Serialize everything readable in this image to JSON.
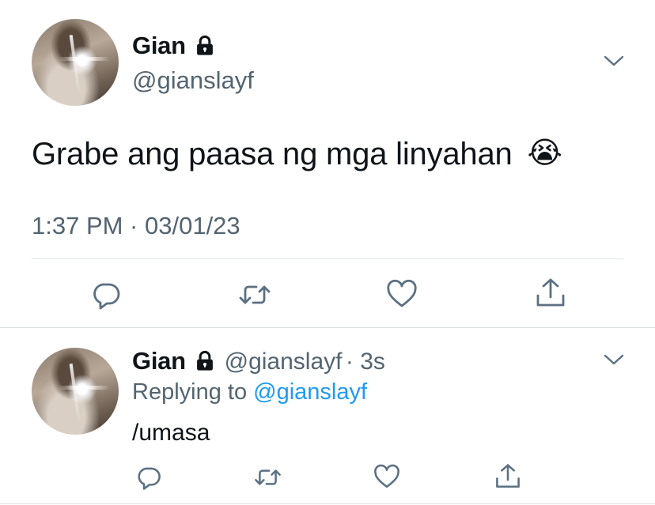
{
  "main_tweet": {
    "display_name": "Gian",
    "handle": "@gianslayf",
    "text": "Grabe ang paasa ng mga linyahan",
    "emoji": "😭",
    "timestamp": "1:37 PM · 03/01/23"
  },
  "reply_tweet": {
    "display_name": "Gian",
    "handle": "@gianslayf",
    "age": "· 3s",
    "replying_prefix": "Replying to",
    "replying_handle": "@gianslayf",
    "text": "/umasa"
  },
  "icons": {
    "reply": "reply-icon",
    "retweet": "retweet-icon",
    "like": "heart-icon",
    "share": "share-icon",
    "more": "chevron-down-icon",
    "protected": "lock-icon"
  },
  "colors": {
    "icon": "#5b7083",
    "link": "#1d9bf0",
    "secondary_text": "#536471"
  }
}
